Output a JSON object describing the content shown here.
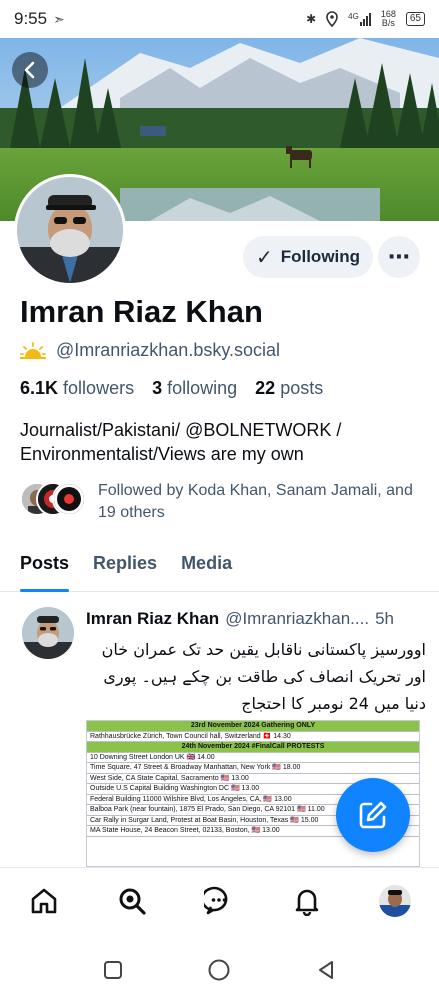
{
  "status_bar": {
    "time": "9:55",
    "network": "4G",
    "speed_value": "168",
    "speed_unit": "B/s",
    "battery": "65"
  },
  "profile": {
    "display_name": "Imran Riaz Khan",
    "handle": "@Imranriazkhan.bsky.social",
    "following_label": "Following",
    "more_label": "⋯",
    "stats": {
      "followers_count": "6.1K",
      "followers_label": "followers",
      "following_count": "3",
      "following_label": "following",
      "posts_count": "22",
      "posts_label": "posts"
    },
    "bio": "Journalist/Pakistani/ @BOLNETWORK / Environmentalist/Views are my own",
    "followed_by": "Followed by Koda Khan, Sanam Jamali, and 19 others"
  },
  "tabs": [
    "Posts",
    "Replies",
    "Media"
  ],
  "post": {
    "author_name": "Imran Riaz Khan",
    "author_handle": "@Imranriazkhan....",
    "time": "5h",
    "text": "اوورسیز پاکستانی ناقابل یقین حد تک عمران خان اور تحریک انصاف کی طاقت بن چکے ہیں۔ پوری دنیا میں 24 نومبر کا احتجاج",
    "image_rows": [
      {
        "text": "23rd November 2024 Gathering ONLY",
        "kind": "head"
      },
      {
        "text": "Rathhausbrücke Zürich, Town Council hall, Switzerland 🇨🇭 14.30",
        "kind": "row"
      },
      {
        "text": "24th November 2024 #FinalCall PROTESTS",
        "kind": "head"
      },
      {
        "text": "10 Downing Street London UK 🇬🇧 14.00",
        "kind": "row"
      },
      {
        "text": "Time Square, 47 Street & Broadway Manhattan, New York 🇺🇸 18.00",
        "kind": "row"
      },
      {
        "text": "West Side, CA State Capital, Sacramento 🇺🇸 13.00",
        "kind": "row"
      },
      {
        "text": "Outside U.S Capital Building Washington DC 🇺🇸 13.00",
        "kind": "row"
      },
      {
        "text": "Federal Building 11000 Wilshire Blvd, Los Angeles, CA, 🇺🇸 13.00",
        "kind": "row"
      },
      {
        "text": "Balboa Park (near fountain), 1875 El Prado, San Diego, CA 92101 🇺🇸 11.00",
        "kind": "row"
      },
      {
        "text": "Car Rally in Surgar Land, Protest at Boat Basin, Houston, Texas 🇺🇸 15.00",
        "kind": "row"
      },
      {
        "text": "MA State House, 24 Beacon Street, 02133, Boston, 🇺🇸 13.00",
        "kind": "row"
      }
    ]
  },
  "nav": [
    "home-icon",
    "search-icon",
    "chat-icon",
    "bell-icon",
    "profile-avatar"
  ],
  "colors": {
    "accent": "#1083fe",
    "muted_text": "#42576c",
    "button_bg": "#eef2f6"
  }
}
